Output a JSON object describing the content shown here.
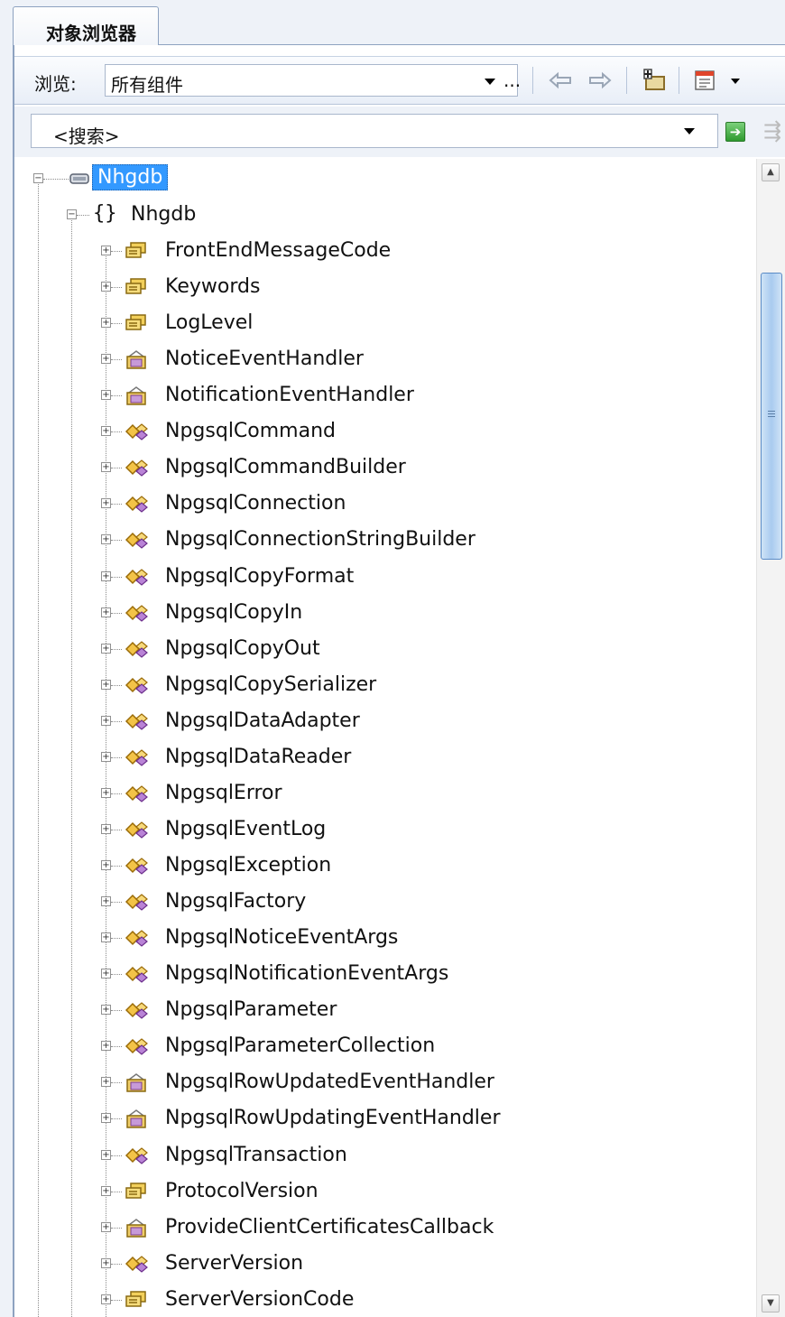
{
  "tab": {
    "title": "对象浏览器"
  },
  "toolbar": {
    "browse_label": "浏览:",
    "browse_value": "所有组件",
    "more_label": "...",
    "back_icon": "back-arrow-icon",
    "forward_icon": "forward-arrow-icon"
  },
  "search": {
    "text": "<搜索>"
  },
  "tree": {
    "root": {
      "label": "Nhgdb",
      "icon": "assembly-icon",
      "selected": true
    },
    "namespace": {
      "label": "Nhgdb",
      "icon": "namespace-icon"
    },
    "items": [
      {
        "label": "FrontEndMessageCode",
        "icon": "enum-icon"
      },
      {
        "label": "Keywords",
        "icon": "enum-icon"
      },
      {
        "label": "LogLevel",
        "icon": "enum-icon"
      },
      {
        "label": "NoticeEventHandler",
        "icon": "delegate-icon"
      },
      {
        "label": "NotificationEventHandler",
        "icon": "delegate-icon"
      },
      {
        "label": "NpgsqlCommand",
        "icon": "class-icon"
      },
      {
        "label": "NpgsqlCommandBuilder",
        "icon": "class-icon"
      },
      {
        "label": "NpgsqlConnection",
        "icon": "class-icon"
      },
      {
        "label": "NpgsqlConnectionStringBuilder",
        "icon": "class-icon"
      },
      {
        "label": "NpgsqlCopyFormat",
        "icon": "class-icon"
      },
      {
        "label": "NpgsqlCopyIn",
        "icon": "class-icon"
      },
      {
        "label": "NpgsqlCopyOut",
        "icon": "class-icon"
      },
      {
        "label": "NpgsqlCopySerializer",
        "icon": "class-icon"
      },
      {
        "label": "NpgsqlDataAdapter",
        "icon": "class-icon"
      },
      {
        "label": "NpgsqlDataReader",
        "icon": "class-icon"
      },
      {
        "label": "NpgsqlError",
        "icon": "class-icon"
      },
      {
        "label": "NpgsqlEventLog",
        "icon": "class-icon"
      },
      {
        "label": "NpgsqlException",
        "icon": "class-icon"
      },
      {
        "label": "NpgsqlFactory",
        "icon": "class-icon"
      },
      {
        "label": "NpgsqlNoticeEventArgs",
        "icon": "class-icon"
      },
      {
        "label": "NpgsqlNotificationEventArgs",
        "icon": "class-icon"
      },
      {
        "label": "NpgsqlParameter",
        "icon": "class-icon"
      },
      {
        "label": "NpgsqlParameterCollection",
        "icon": "class-icon"
      },
      {
        "label": "NpgsqlRowUpdatedEventHandler",
        "icon": "delegate-icon"
      },
      {
        "label": "NpgsqlRowUpdatingEventHandler",
        "icon": "delegate-icon"
      },
      {
        "label": "NpgsqlTransaction",
        "icon": "class-icon"
      },
      {
        "label": "ProtocolVersion",
        "icon": "enum-icon"
      },
      {
        "label": "ProvideClientCertificatesCallback",
        "icon": "delegate-icon"
      },
      {
        "label": "ServerVersion",
        "icon": "class-icon"
      },
      {
        "label": "ServerVersionCode",
        "icon": "enum-icon"
      }
    ]
  },
  "colors": {
    "selection": "#3399ff",
    "frame_border": "#8da2c0",
    "toolbar_bg": "#e8eef7"
  }
}
